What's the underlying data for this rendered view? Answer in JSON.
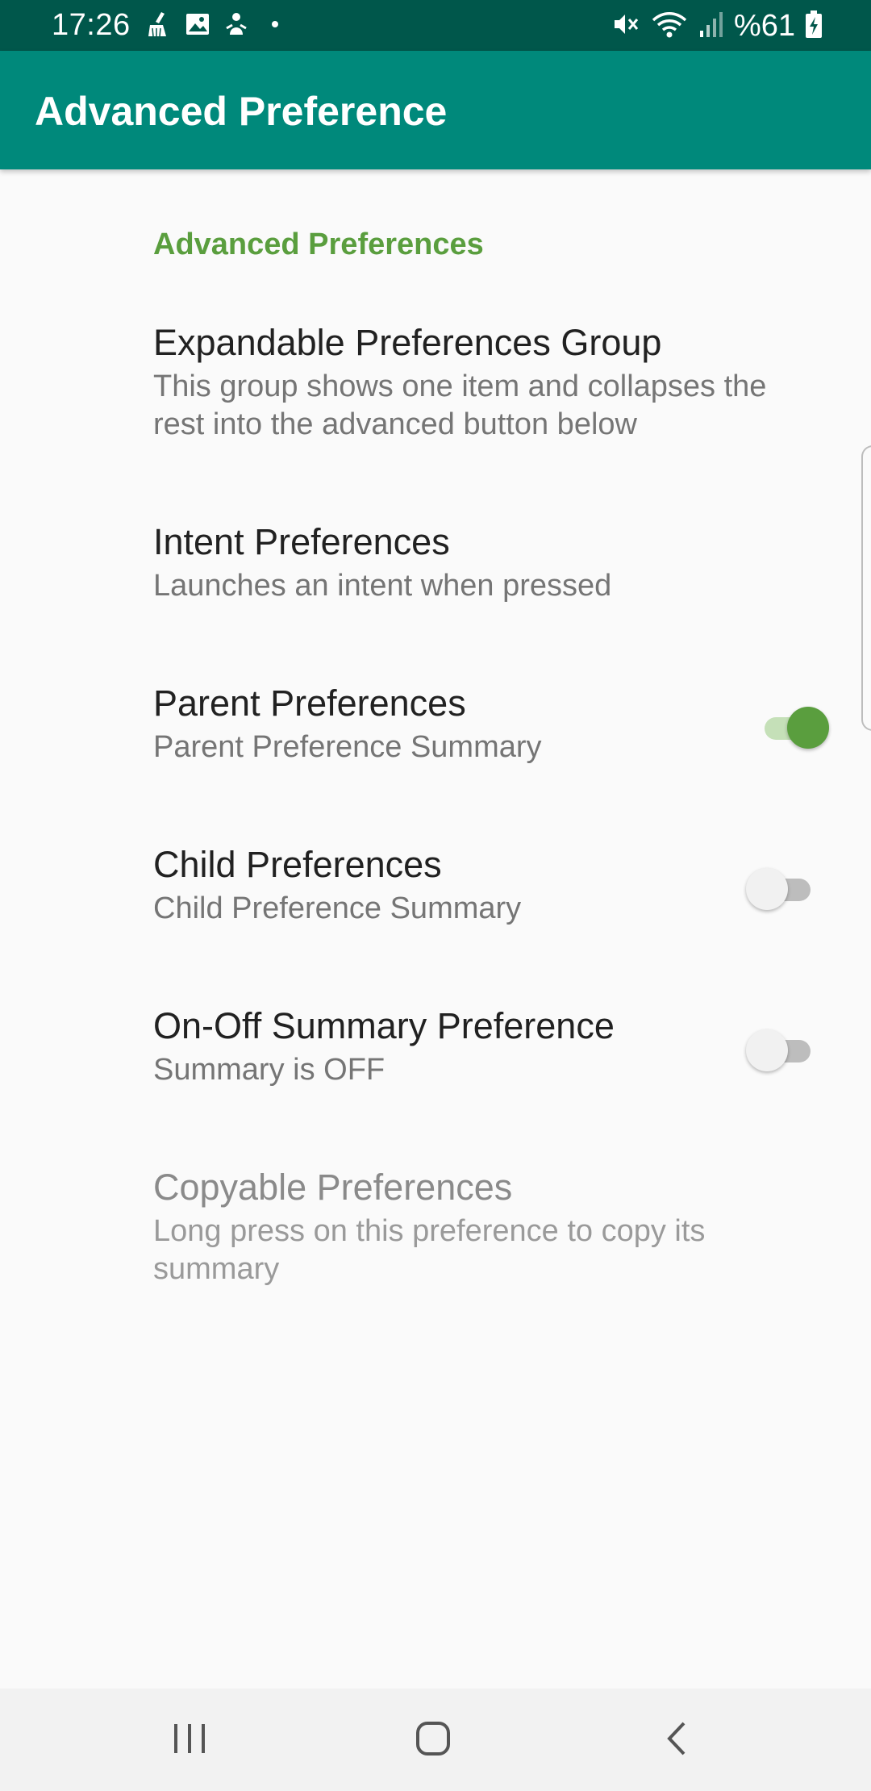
{
  "status_bar": {
    "time": "17:26",
    "battery": "%61",
    "left_icons": [
      "clean-icon",
      "image-icon",
      "app-notification-icon",
      "dot-icon"
    ],
    "right_icons": [
      "vibrate-mute-icon",
      "wifi-icon",
      "signal-icon",
      "battery-charging-icon"
    ]
  },
  "app_bar": {
    "title": "Advanced Preference",
    "color": "#00897b"
  },
  "category": {
    "title": "Advanced Preferences",
    "color": "#5a9e3e"
  },
  "preferences": [
    {
      "title": "Expandable Preferences Group",
      "summary": "This group shows one item and collapses the rest into the advanced button below"
    },
    {
      "title": "Intent Preferences",
      "summary": "Launches an intent when pressed"
    },
    {
      "title": "Parent Preferences",
      "summary": "Parent Preference Summary",
      "switch": "on"
    },
    {
      "title": "Child Preferences",
      "summary": "Child Preference Summary",
      "switch": "off"
    },
    {
      "title": "On-Off Summary Preference",
      "summary": "Summary is  OFF",
      "switch": "off"
    },
    {
      "title": "Copyable Preferences",
      "summary": "Long press  on this preference to copy its summary",
      "enabled": false
    }
  ],
  "nav_bar": {
    "buttons": [
      "recents-icon",
      "home-icon",
      "back-icon"
    ]
  }
}
